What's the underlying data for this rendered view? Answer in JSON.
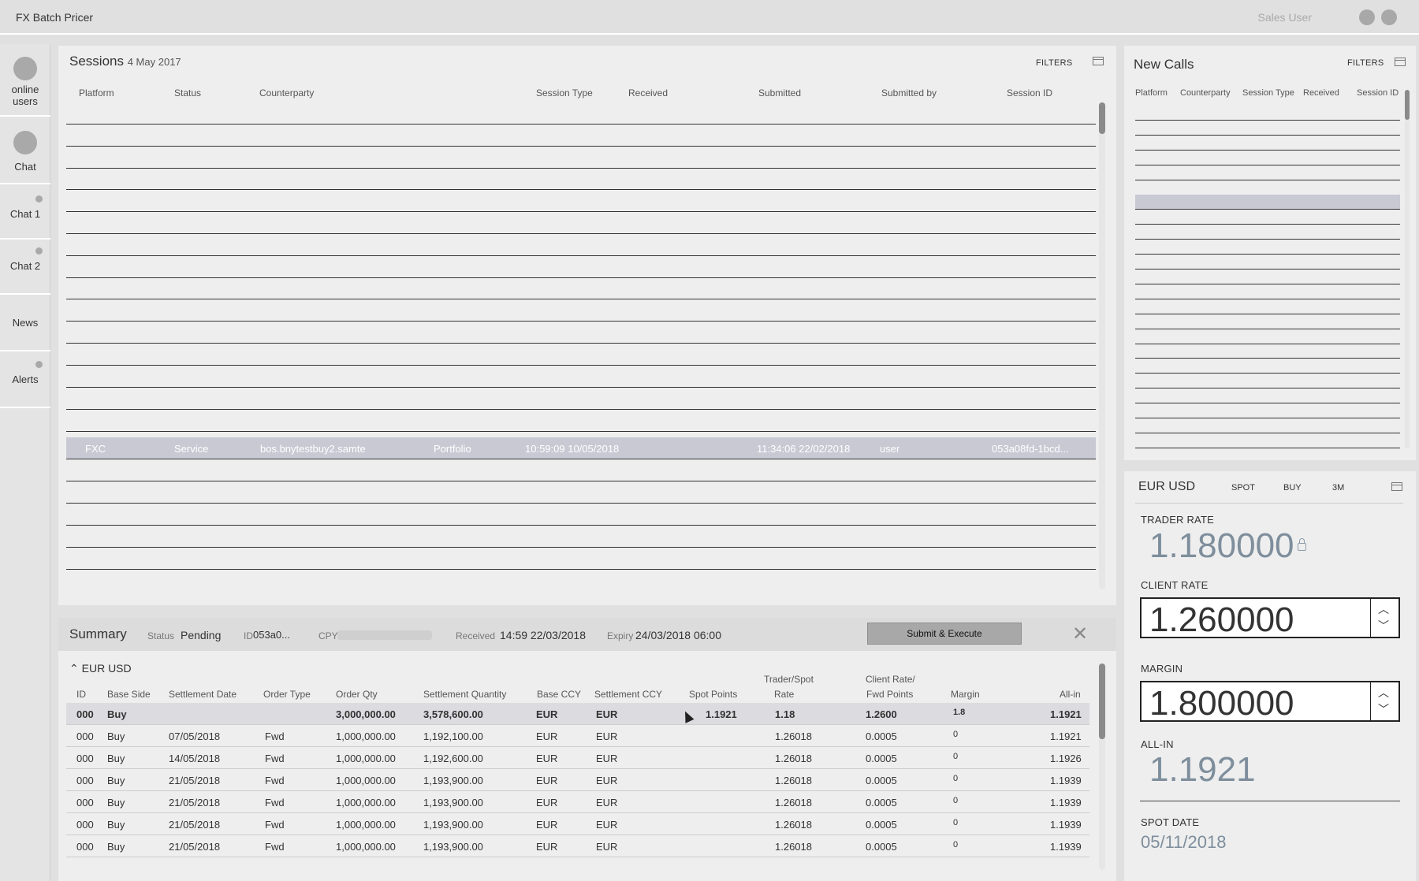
{
  "app": {
    "title": "FX Batch Pricer",
    "user": "Sales User"
  },
  "sidebar": {
    "items": [
      {
        "label": "online\nusers",
        "line1": "online",
        "line2": "users"
      },
      {
        "label": "Chat"
      },
      {
        "label": "Chat 1"
      },
      {
        "label": "Chat 2"
      },
      {
        "label": "News"
      },
      {
        "label": "Alerts"
      }
    ]
  },
  "sessions": {
    "title": "Sessions",
    "date": "4 May 2017",
    "filters_label": "FILTERS",
    "columns": [
      "Platform",
      "Status",
      "Counterparty",
      "Session Type",
      "Received",
      "Submitted",
      "Submitted by",
      "Session ID"
    ],
    "selected_row": {
      "platform": "FXC",
      "status": "Service",
      "counterparty": "bos.bnytestbuy2.samte",
      "session_type": "Portfolio",
      "received": "10:59:09 10/05/2018",
      "submitted": "11:34:06 22/02/2018",
      "submitted_by": "user",
      "session_id": "053a08fd-1bcd..."
    }
  },
  "new_calls": {
    "title": "New Calls",
    "filters_label": "FILTERS",
    "columns": [
      "Platform",
      "Counterparty",
      "Session Type",
      "Received",
      "Session ID"
    ]
  },
  "summary": {
    "title": "Summary",
    "status_label": "Status",
    "status_value": "Pending",
    "id_label": "ID",
    "id_value": "053a0...",
    "cpy_label": "CPY",
    "received_label": "Received",
    "received_value": "14:59 22/03/2018",
    "expiry_label": "Expiry",
    "expiry_value": "24/03/2018 06:00",
    "submit_label": "Submit & Execute",
    "group_label": "EUR USD",
    "columns": {
      "id": "ID",
      "base_side": "Base Side",
      "settlement_date": "Settlement Date",
      "order_type": "Order Type",
      "order_qty": "Order Qty",
      "settlement_qty": "Settlement Quantity",
      "base_ccy": "Base CCY",
      "settlement_ccy": "Settlement CCY",
      "spot_points": "Spot Points",
      "trader_spot_1": "Trader/Spot",
      "trader_spot_2": "Rate",
      "client_rate_1": "Client Rate/",
      "client_rate_2": "Fwd Points",
      "margin": "Margin",
      "all_in": "All-in"
    },
    "rows": [
      {
        "id": "000",
        "side": "Buy",
        "date": "",
        "type": "",
        "qty": "3,000,000.00",
        "sqty": "3,578,600.00",
        "bccy": "EUR",
        "sccy": "EUR",
        "spot": "1.1921",
        "trader": "1.18",
        "client": "1.2600",
        "margin": "1.8",
        "allin": "1.1921"
      },
      {
        "id": "000",
        "side": "Buy",
        "date": "07/05/2018",
        "type": "Fwd",
        "qty": "1,000,000.00",
        "sqty": "1,192,100.00",
        "bccy": "EUR",
        "sccy": "EUR",
        "spot": "",
        "trader": "1.26018",
        "client": "0.0005",
        "margin": "0",
        "allin": "1.1921"
      },
      {
        "id": "000",
        "side": "Buy",
        "date": "14/05/2018",
        "type": "Fwd",
        "qty": "1,000,000.00",
        "sqty": "1,192,600.00",
        "bccy": "EUR",
        "sccy": "EUR",
        "spot": "",
        "trader": "1.26018",
        "client": "0.0005",
        "margin": "0",
        "allin": "1.1926"
      },
      {
        "id": "000",
        "side": "Buy",
        "date": "21/05/2018",
        "type": "Fwd",
        "qty": "1,000,000.00",
        "sqty": "1,193,900.00",
        "bccy": "EUR",
        "sccy": "EUR",
        "spot": "",
        "trader": "1.26018",
        "client": "0.0005",
        "margin": "0",
        "allin": "1.1939"
      },
      {
        "id": "000",
        "side": "Buy",
        "date": "21/05/2018",
        "type": "Fwd",
        "qty": "1,000,000.00",
        "sqty": "1,193,900.00",
        "bccy": "EUR",
        "sccy": "EUR",
        "spot": "",
        "trader": "1.26018",
        "client": "0.0005",
        "margin": "0",
        "allin": "1.1939"
      },
      {
        "id": "000",
        "side": "Buy",
        "date": "21/05/2018",
        "type": "Fwd",
        "qty": "1,000,000.00",
        "sqty": "1,193,900.00",
        "bccy": "EUR",
        "sccy": "EUR",
        "spot": "",
        "trader": "1.26018",
        "client": "0.0005",
        "margin": "0",
        "allin": "1.1939"
      },
      {
        "id": "000",
        "side": "Buy",
        "date": "21/05/2018",
        "type": "Fwd",
        "qty": "1,000,000.00",
        "sqty": "1,193,900.00",
        "bccy": "EUR",
        "sccy": "EUR",
        "spot": "",
        "trader": "1.26018",
        "client": "0.0005",
        "margin": "0",
        "allin": "1.1939"
      }
    ]
  },
  "rate_panel": {
    "pair": "EUR USD",
    "tabs": [
      "SPOT",
      "BUY",
      "3M"
    ],
    "trader_rate_label": "TRADER RATE",
    "trader_rate_value": "1.180000",
    "client_rate_label": "CLIENT RATE",
    "client_rate_value": "1.260000",
    "margin_label": "MARGIN",
    "margin_value": "1.800000",
    "all_in_label": "ALL-IN",
    "all_in_value": "1.1921",
    "spot_date_label": "SPOT DATE",
    "spot_date_value": "05/11/2018"
  },
  "colors": {
    "background": "#e0e0e0",
    "panel": "#eeeeee",
    "selected_row": "#c9c9d4",
    "rate_value": "#7e8e9c"
  }
}
